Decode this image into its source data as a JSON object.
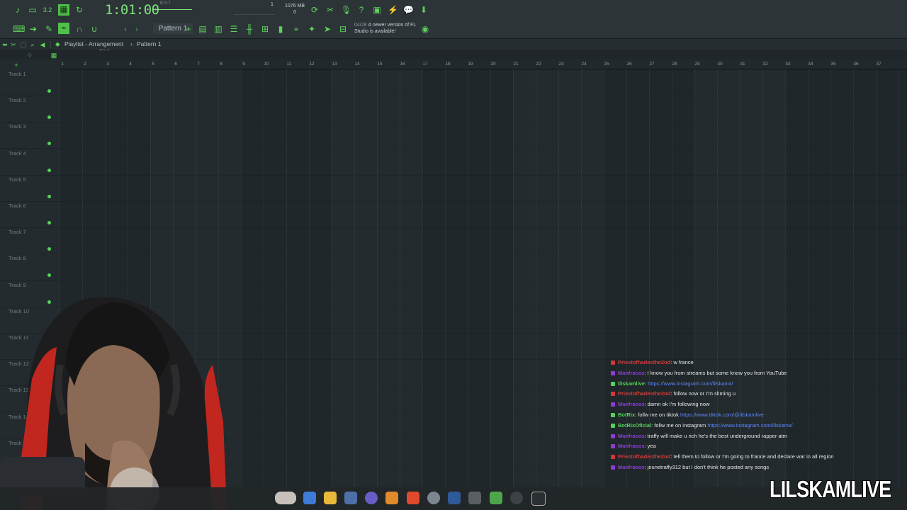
{
  "toolbar": {
    "time": "1:01:00",
    "time_small": "B:S:T",
    "tempo_small": "3.2",
    "memory_value": "1076 MB",
    "memory_sub": "0",
    "cpu_value": "1",
    "pattern": "Pattern 1",
    "snap": "Line",
    "news_date": "04/28",
    "news_text": "A newer version of FL Studio is available!"
  },
  "breadcrumb": {
    "playlist": "Playlist - Arrangement",
    "pattern": "Pattern 1"
  },
  "ruler": {
    "marks": [
      "1",
      "2",
      "3",
      "4",
      "5",
      "6",
      "7",
      "8",
      "9",
      "10",
      "11",
      "12",
      "13",
      "14",
      "15",
      "16",
      "17",
      "18",
      "19",
      "20",
      "21",
      "22",
      "23",
      "24",
      "25",
      "26",
      "27",
      "28",
      "29",
      "30",
      "31",
      "32",
      "33",
      "34",
      "35",
      "36",
      "37"
    ]
  },
  "tracks": [
    "Track 1",
    "Track 2",
    "Track 3",
    "Track 4",
    "Track 5",
    "Track 6",
    "Track 7",
    "Track 8",
    "Track 9",
    "Track 10",
    "Track 11",
    "Track 12",
    "Track 13",
    "Track 14",
    "Track 15"
  ],
  "chat": [
    {
      "user": "Priestofhadesthe2nd",
      "text": ": w france",
      "color": "#d03a3a",
      "link": ""
    },
    {
      "user": "Manfracos",
      "text": ": I know you from streams but some know you from YouTube",
      "color": "#8a3fd0",
      "link": ""
    },
    {
      "user": "lilskamlive",
      "text": ":",
      "color": "#55d15a",
      "link": "https://www.instagram.com/lilskamx/"
    },
    {
      "user": "Priestofhadesthe2nd",
      "text": ": follow now or I'm slIming u",
      "color": "#d03a3a",
      "link": ""
    },
    {
      "user": "Manfracos",
      "text": ": damn ok I'm following now",
      "color": "#8a3fd0",
      "link": ""
    },
    {
      "user": "BotRix",
      "text": ": follw me on tiktok",
      "color": "#55d15a",
      "link": "https://www.tiktok.com/@lilskamlive"
    },
    {
      "user": "BotRixOficial",
      "text": ": follw me on instagram",
      "color": "#55d15a",
      "link": "https://www.instagram.com/lilskamx/"
    },
    {
      "user": "Manfracos",
      "text": ": traffy will make u rich he's the best underground rapper atm",
      "color": "#8a3fd0",
      "link": ""
    },
    {
      "user": "Manfracos",
      "text": ": yea",
      "color": "#8a3fd0",
      "link": ""
    },
    {
      "user": "Priestofhadesthe2nd",
      "text": ": tell them to follow or I'm going to france and declare war in all region",
      "color": "#d03a3a",
      "link": ""
    },
    {
      "user": "Manfracos",
      "text": ": jeunetraffy312 but I don't think he posted any songs",
      "color": "#8a3fd0",
      "link": ""
    }
  ],
  "watermark": "LILSKAMLIVE",
  "colors": {
    "accent": "#55d15a",
    "background": "#20262a",
    "chat_link": "#5b86ff"
  }
}
